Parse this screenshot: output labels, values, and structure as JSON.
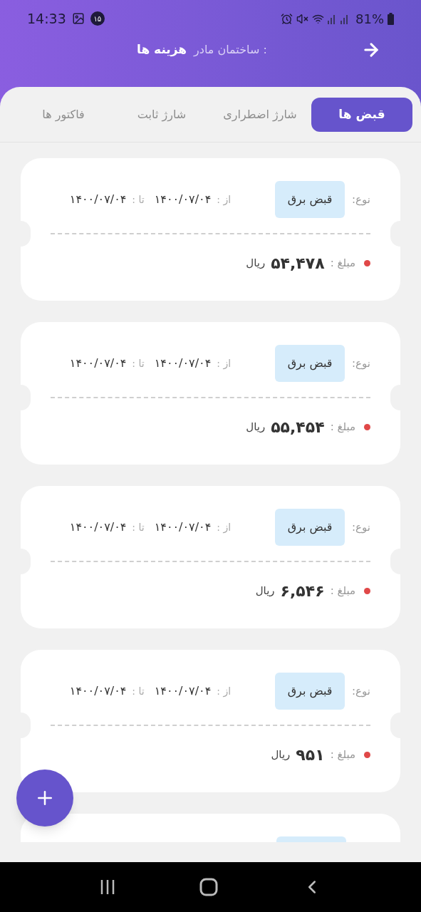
{
  "status_bar": {
    "time": "14:33",
    "notification_count": "۱۵",
    "battery": "81%"
  },
  "header": {
    "prefix": "ساختمان مادر :",
    "title": "هزینه ها"
  },
  "tabs": [
    {
      "label": "قبض ها",
      "selected": true
    },
    {
      "label": "شارژ اضطراری",
      "selected": false
    },
    {
      "label": "شارژ ثابت",
      "selected": false
    },
    {
      "label": "فاکتور ها",
      "selected": false
    }
  ],
  "bills": [
    {
      "type_label": "نوع:",
      "type": "قبض برق",
      "from_label": "از :",
      "from": "۱۴۰۰/۰۷/۰۴",
      "to_label": "تا :",
      "to": "۱۴۰۰/۰۷/۰۴",
      "amount_label": "مبلغ :",
      "amount": "۵۴,۴۷۸",
      "currency": "ریال"
    },
    {
      "type_label": "نوع:",
      "type": "قبض برق",
      "from_label": "از :",
      "from": "۱۴۰۰/۰۷/۰۴",
      "to_label": "تا :",
      "to": "۱۴۰۰/۰۷/۰۴",
      "amount_label": "مبلغ :",
      "amount": "۵۵,۴۵۴",
      "currency": "ریال"
    },
    {
      "type_label": "نوع:",
      "type": "قبض برق",
      "from_label": "از :",
      "from": "۱۴۰۰/۰۷/۰۴",
      "to_label": "تا :",
      "to": "۱۴۰۰/۰۷/۰۴",
      "amount_label": "مبلغ :",
      "amount": "۶,۵۴۶",
      "currency": "ریال"
    },
    {
      "type_label": "نوع:",
      "type": "قبض برق",
      "from_label": "از :",
      "from": "۱۴۰۰/۰۷/۰۴",
      "to_label": "تا :",
      "to": "۱۴۰۰/۰۷/۰۴",
      "amount_label": "مبلغ :",
      "amount": "۹۵۱",
      "currency": "ریال"
    }
  ]
}
